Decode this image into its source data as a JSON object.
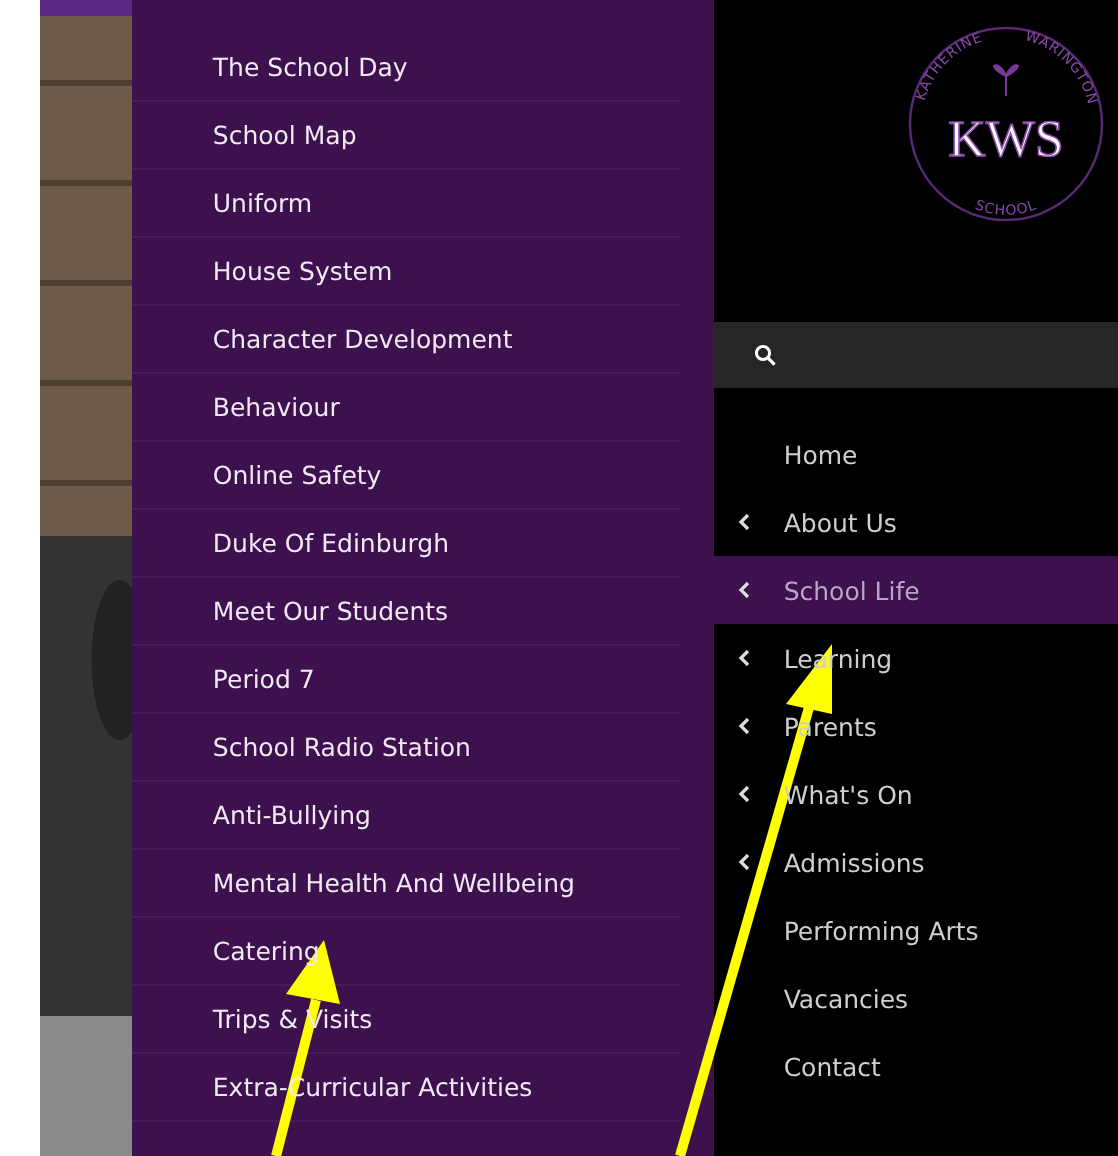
{
  "submenu": {
    "items": [
      {
        "label": "The School Day"
      },
      {
        "label": "School Map"
      },
      {
        "label": "Uniform"
      },
      {
        "label": "House System"
      },
      {
        "label": "Character Development"
      },
      {
        "label": "Behaviour"
      },
      {
        "label": "Online Safety"
      },
      {
        "label": "Duke Of Edinburgh"
      },
      {
        "label": "Meet Our Students"
      },
      {
        "label": "Period 7"
      },
      {
        "label": "School Radio Station"
      },
      {
        "label": "Anti-Bullying"
      },
      {
        "label": "Mental Health And Wellbeing"
      },
      {
        "label": "Catering"
      },
      {
        "label": "Trips & Visits"
      },
      {
        "label": "Extra-Curricular Activities"
      }
    ]
  },
  "logo": {
    "ring_left": "KATHERINE",
    "ring_right": "WARINGTON",
    "ring_bottom": "SCHOOL",
    "initials": "KWS"
  },
  "nav": {
    "items": [
      {
        "label": "Home",
        "has_submenu": false,
        "selected": false
      },
      {
        "label": "About Us",
        "has_submenu": true,
        "selected": false
      },
      {
        "label": "School Life",
        "has_submenu": true,
        "selected": true
      },
      {
        "label": "Learning",
        "has_submenu": true,
        "selected": false
      },
      {
        "label": "Parents",
        "has_submenu": true,
        "selected": false
      },
      {
        "label": "What's On",
        "has_submenu": true,
        "selected": false
      },
      {
        "label": "Admissions",
        "has_submenu": true,
        "selected": false
      },
      {
        "label": "Performing Arts",
        "has_submenu": false,
        "selected": false
      },
      {
        "label": "Vacancies",
        "has_submenu": false,
        "selected": false
      },
      {
        "label": "Contact",
        "has_submenu": false,
        "selected": false
      }
    ]
  }
}
